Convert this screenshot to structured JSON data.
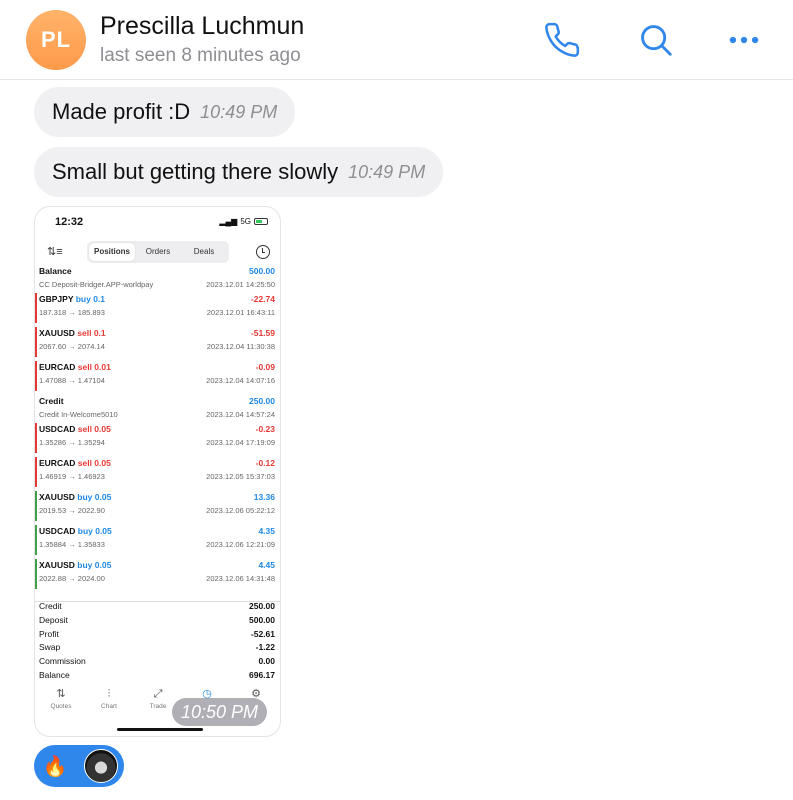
{
  "header": {
    "avatar_initials": "PL",
    "contact_name": "Prescilla Luchmun",
    "status": "last seen 8 minutes ago",
    "accent_color": "#2f86eb",
    "icons": [
      "phone-icon",
      "search-icon",
      "more-icon"
    ]
  },
  "messages": [
    {
      "text": "Made profit :D",
      "time": "10:49 PM"
    },
    {
      "text": "Small but getting there slowly",
      "time": "10:49 PM"
    }
  ],
  "photo": {
    "time": "10:50 PM",
    "phone": {
      "clock": "12:32",
      "network": "5G",
      "tabs": [
        "Positions",
        "Orders",
        "Deals"
      ],
      "active_tab": "Positions",
      "deals": [
        {
          "symbol": "Balance",
          "side": "",
          "prices": "CC Deposit-Bridger.APP-worldpay",
          "pnl": "500.00",
          "datetime": "2023.12.01 14:25:50",
          "kind": "balance"
        },
        {
          "symbol": "GBPJPY",
          "side": "buy 0.1",
          "prices": "187.318 → 185.893",
          "pnl": "-22.74",
          "datetime": "2023.12.01 16:43:11",
          "kind": "loss"
        },
        {
          "symbol": "XAUUSD",
          "side": "sell 0.1",
          "prices": "2067.60 → 2074.14",
          "pnl": "-51.59",
          "datetime": "2023.12.04 11:30:38",
          "kind": "loss"
        },
        {
          "symbol": "EURCAD",
          "side": "sell 0.01",
          "prices": "1.47088 → 1.47104",
          "pnl": "-0.09",
          "datetime": "2023.12.04 14:07:16",
          "kind": "loss"
        },
        {
          "symbol": "Credit",
          "side": "",
          "prices": "Credit In-Welcome5010",
          "pnl": "250.00",
          "datetime": "2023.12.04 14:57:24",
          "kind": "balance"
        },
        {
          "symbol": "USDCAD",
          "side": "sell 0.05",
          "prices": "1.35286 → 1.35294",
          "pnl": "-0.23",
          "datetime": "2023.12.04 17:19:09",
          "kind": "loss"
        },
        {
          "symbol": "EURCAD",
          "side": "sell 0.05",
          "prices": "1.46919 → 1.46923",
          "pnl": "-0.12",
          "datetime": "2023.12.05 15:37:03",
          "kind": "loss"
        },
        {
          "symbol": "XAUUSD",
          "side": "buy 0.05",
          "prices": "2019.53 → 2022.90",
          "pnl": "13.36",
          "datetime": "2023.12.06 05:22:12",
          "kind": "profit"
        },
        {
          "symbol": "USDCAD",
          "side": "buy 0.05",
          "prices": "1.35884 → 1.35833",
          "pnl": "4.35",
          "datetime": "2023.12.06 12:21:09",
          "kind": "profit"
        },
        {
          "symbol": "XAUUSD",
          "side": "buy 0.05",
          "prices": "2022.88 → 2024.00",
          "pnl": "4.45",
          "datetime": "2023.12.06 14:31:48",
          "kind": "profit"
        }
      ],
      "summary": [
        {
          "label": "Credit",
          "value": "250.00"
        },
        {
          "label": "Deposit",
          "value": "500.00"
        },
        {
          "label": "Profit",
          "value": "-52.61"
        },
        {
          "label": "Swap",
          "value": "-1.22"
        },
        {
          "label": "Commission",
          "value": "0.00"
        },
        {
          "label": "Balance",
          "value": "696.17"
        }
      ],
      "nav": [
        "Quotes",
        "Chart",
        "Trade",
        "History",
        "Settings"
      ],
      "colors": {
        "buy": "#1e88e5",
        "sell": "#e53935",
        "loss_bar": "#e53935",
        "profit_bar": "#43a047"
      }
    }
  },
  "reaction": {
    "emoji": "🔥"
  }
}
